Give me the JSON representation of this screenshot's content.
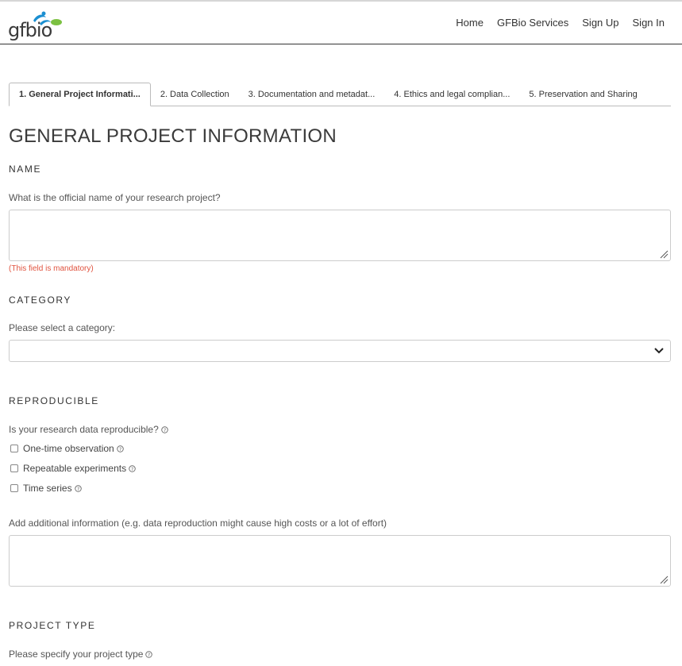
{
  "brand": {
    "logo_text": "gfbio"
  },
  "nav": {
    "items": [
      "Home",
      "GFBio Services",
      "Sign Up",
      "Sign In"
    ]
  },
  "tabs": [
    "1. General Project Informati...",
    "2. Data Collection",
    "3. Documentation and metadat...",
    "4. Ethics and legal complian...",
    "5. Preservation and Sharing"
  ],
  "page": {
    "title": "GENERAL PROJECT INFORMATION"
  },
  "name_section": {
    "title": "NAME",
    "question": "What is the official name of your research project?",
    "value": "",
    "mandatory_note": "(This field is mandatory)"
  },
  "category_section": {
    "title": "CATEGORY",
    "question": "Please select a category:",
    "selected": ""
  },
  "reproducible_section": {
    "title": "REPRODUCIBLE",
    "question": "Is your research data reproducible?",
    "options": [
      "One-time observation",
      "Repeatable experiments",
      "Time series"
    ],
    "additional_label": "Add additional information (e.g. data reproduction might cause high costs or a lot of effort)",
    "additional_value": ""
  },
  "project_type_section": {
    "title": "PROJECT TYPE",
    "question": "Please specify your project type"
  },
  "colors": {
    "mandatory": "#e0533f",
    "logo_blue": "#1b8fd1",
    "logo_green": "#7cc142"
  }
}
